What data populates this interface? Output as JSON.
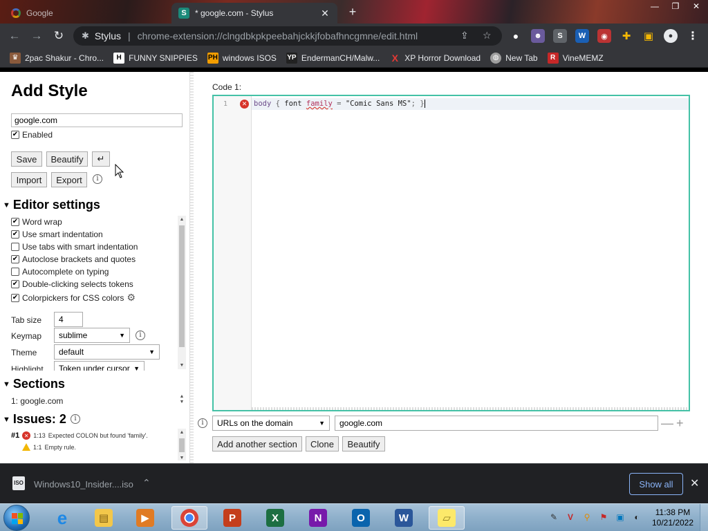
{
  "tabs": [
    {
      "title": "Google",
      "active": false
    },
    {
      "title": "* google.com - Stylus",
      "active": true
    }
  ],
  "toolbar": {
    "extension_name": "Stylus",
    "url": "chrome-extension://clngdbkpkpeebahjckkjfobafhncgmne/edit.html"
  },
  "bookmarks": [
    {
      "label": "2pac Shakur - Chro...",
      "icon": "2pac-icon"
    },
    {
      "label": "FUNNY SNIPPIES",
      "icon": "H"
    },
    {
      "label": "windows ISOS",
      "icon": "PH"
    },
    {
      "label": "EndermanCH/Malw...",
      "icon": "YP"
    },
    {
      "label": "XP Horror Download",
      "icon": "X"
    },
    {
      "label": "New Tab",
      "icon": "globe-icon"
    },
    {
      "label": "VineMEMZ",
      "icon": "R"
    }
  ],
  "left": {
    "heading": "Add Style",
    "style_name": "google.com",
    "enabled_label": "Enabled",
    "buttons": {
      "save": "Save",
      "beautify": "Beautify",
      "undo": "↵",
      "import": "Import",
      "export": "Export"
    },
    "editor_settings": {
      "heading": "Editor settings",
      "options": [
        {
          "label": "Word wrap",
          "checked": true
        },
        {
          "label": "Use smart indentation",
          "checked": true
        },
        {
          "label": "Use tabs with smart indentation",
          "checked": false
        },
        {
          "label": "Autoclose brackets and quotes",
          "checked": true
        },
        {
          "label": "Autocomplete on typing",
          "checked": false
        },
        {
          "label": "Double-clicking selects tokens",
          "checked": true
        },
        {
          "label": "Colorpickers for CSS colors",
          "checked": true
        }
      ],
      "tab_size_label": "Tab size",
      "tab_size": "4",
      "keymap_label": "Keymap",
      "keymap": "sublime",
      "theme_label": "Theme",
      "theme": "default",
      "highlight_label": "Highlight",
      "highlight": "Token under cursor"
    },
    "sections": {
      "heading": "Sections",
      "items": [
        "1: google.com"
      ]
    },
    "issues": {
      "heading": "Issues: 2",
      "items": [
        {
          "num": "#1",
          "pos": "1:13",
          "message": "Expected COLON but found 'family'."
        },
        {
          "num": "",
          "pos": "1:1",
          "message": "Empty rule."
        }
      ]
    }
  },
  "editor": {
    "code_label": "Code 1:",
    "line_number": "1",
    "code": {
      "selector": "body",
      "open": "{",
      "prop": "font",
      "error_token": "family",
      "eq": "=",
      "value": "\"Comic Sans MS\"",
      "semi": ";",
      "close": "}"
    },
    "applies_to": {
      "type": "URLs on the domain",
      "value": "google.com"
    },
    "buttons": {
      "add_section": "Add another section",
      "clone": "Clone",
      "beautify": "Beautify"
    }
  },
  "download": {
    "filename": "Windows10_Insider....iso",
    "show_all": "Show all"
  },
  "taskbar": {
    "apps": [
      "Internet Explorer",
      "File Explorer",
      "Media Player",
      "Chrome",
      "PowerPoint",
      "Excel",
      "OneNote",
      "Outlook",
      "Word",
      "Sticky Notes"
    ],
    "time": "11:38 PM",
    "date": "10/21/2022"
  }
}
